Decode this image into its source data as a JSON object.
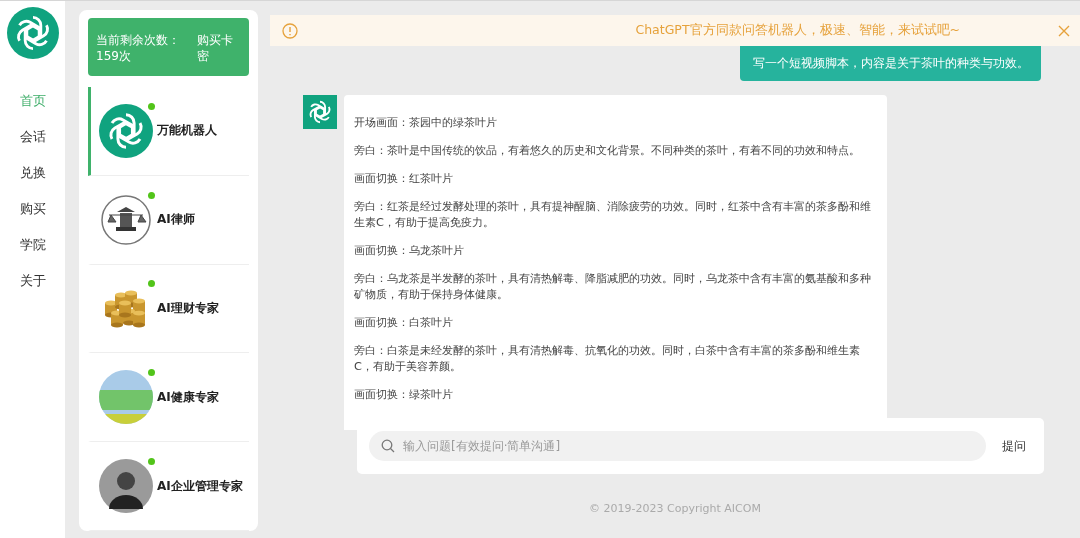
{
  "nav": {
    "items": [
      {
        "label": "首页",
        "selected": true
      },
      {
        "label": "会话",
        "selected": false
      },
      {
        "label": "兑换",
        "selected": false
      },
      {
        "label": "购买",
        "selected": false
      },
      {
        "label": "学院",
        "selected": false
      },
      {
        "label": "关于",
        "selected": false
      }
    ]
  },
  "quota": {
    "text": "当前剩余次数：159次",
    "buy": "购买卡密"
  },
  "bots": [
    {
      "name": "万能机器人",
      "kind": "logo",
      "online": true,
      "selected": true
    },
    {
      "name": "AI律师",
      "kind": "scales",
      "online": true,
      "selected": false
    },
    {
      "name": "AI理财专家",
      "kind": "coins",
      "online": true,
      "selected": false
    },
    {
      "name": "AI健康专家",
      "kind": "photo",
      "online": true,
      "selected": false
    },
    {
      "name": "AI企业管理专家",
      "kind": "portrait",
      "online": true,
      "selected": false
    }
  ],
  "notice": {
    "text": "ChatGPT官方同款问答机器人，极速、智能，来试试吧~"
  },
  "chat": {
    "user_message": "写一个短视频脚本，内容是关于茶叶的种类与功效。",
    "reply": [
      "开场画面：茶园中的绿茶叶片",
      "旁白：茶叶是中国传统的饮品，有着悠久的历史和文化背景。不同种类的茶叶，有着不同的功效和特点。",
      "画面切换：红茶叶片",
      "旁白：红茶是经过发酵处理的茶叶，具有提神醒脑、消除疲劳的功效。同时，红茶中含有丰富的茶多酚和维生素C，有助于提高免疫力。",
      "画面切换：乌龙茶叶片",
      "旁白：乌龙茶是半发酵的茶叶，具有清热解毒、降脂减肥的功效。同时，乌龙茶中含有丰富的氨基酸和多种矿物质，有助于保持身体健康。",
      "画面切换：白茶叶片",
      "旁白：白茶是未经发酵的茶叶，具有清热解毒、抗氧化的功效。同时，白茶中含有丰富的茶多酚和维生素C，有助于美容养颜。",
      "画面切换：绿茶叶片"
    ]
  },
  "input": {
    "placeholder": "输入问题[有效提问·简单沟通]",
    "button": "提问"
  },
  "footer": "© 2019-2023 Copyright AICOM"
}
